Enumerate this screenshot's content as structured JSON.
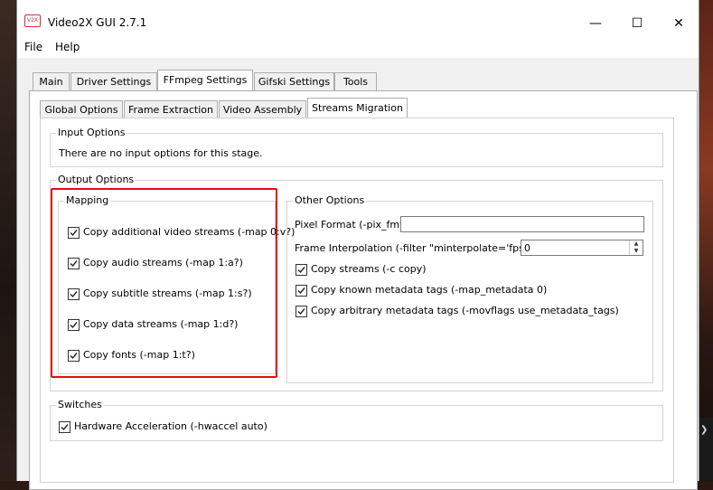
{
  "window": {
    "title": "Video2X GUI 2.7.1",
    "icon_text": "V2X",
    "controls": {
      "minimize": "—",
      "maximize": "☐",
      "close": "✕"
    }
  },
  "menu": [
    "File",
    "Help"
  ],
  "tabs": [
    "Main",
    "Driver Settings",
    "FFmpeg Settings",
    "Gifski Settings",
    "Tools"
  ],
  "active_tab": "FFmpeg Settings",
  "subtabs": [
    "Global Options",
    "Frame Extraction",
    "Video Assembly",
    "Streams Migration"
  ],
  "active_subtab": "Streams Migration",
  "input_options": {
    "title": "Input Options",
    "text": "There are no input options for this stage."
  },
  "output_options": {
    "title": "Output Options",
    "mapping": {
      "title": "Mapping",
      "items": [
        {
          "label": "Copy additional video streams (-map 0:v?)",
          "checked": true
        },
        {
          "label": "Copy audio streams (-map 1:a?)",
          "checked": true
        },
        {
          "label": "Copy subtitle streams (-map 1:s?)",
          "checked": true
        },
        {
          "label": "Copy data streams (-map 1:d?)",
          "checked": true
        },
        {
          "label": "Copy fonts (-map 1:t?)",
          "checked": true
        }
      ]
    },
    "other": {
      "title": "Other Options",
      "pixel_format_label": "Pixel Format (-pix_fmt)",
      "pixel_format_value": "",
      "frame_interp_label": "Frame Interpolation (-filter \"minterpolate='fps=n'\")",
      "frame_interp_value": "0",
      "items": [
        {
          "label": "Copy streams (-c copy)",
          "checked": true
        },
        {
          "label": "Copy known metadata tags (-map_metadata 0)",
          "checked": true
        },
        {
          "label": "Copy arbitrary metadata tags (-movflags use_metadata_tags)",
          "checked": true
        }
      ]
    }
  },
  "switches": {
    "title": "Switches",
    "hwaccel": {
      "label": "Hardware Acceleration (-hwaccel auto)",
      "checked": true
    }
  },
  "colors": {
    "highlight_box": "#e01010"
  }
}
